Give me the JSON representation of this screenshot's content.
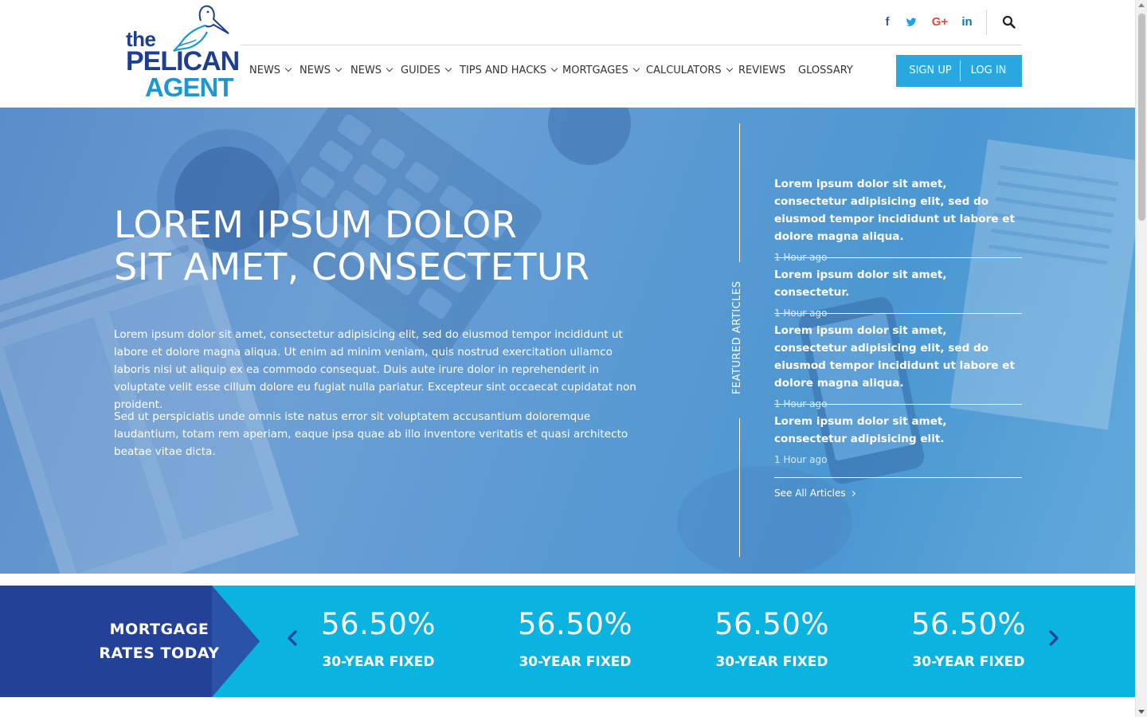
{
  "brand": {
    "logo_the": "the",
    "logo_pelican": "PELICAN",
    "logo_agent": "AGENT",
    "primary_color": "#1e3f8f",
    "accent_color": "#29a8e0"
  },
  "social": {
    "facebook": "f",
    "twitter": "t",
    "googleplus": "G+",
    "linkedin": "in"
  },
  "nav": {
    "items": [
      {
        "label": "NEWS",
        "dropdown": true
      },
      {
        "label": "NEWS",
        "dropdown": true
      },
      {
        "label": "NEWS",
        "dropdown": true
      },
      {
        "label": "GUIDES",
        "dropdown": true
      },
      {
        "label": "TIPS AND HACKS",
        "dropdown": true
      },
      {
        "label": "MORTGAGES",
        "dropdown": true
      },
      {
        "label": "CALCULATORS",
        "dropdown": true
      },
      {
        "label": "REVIEWS",
        "dropdown": false
      },
      {
        "label": "GLOSSARY",
        "dropdown": false
      }
    ]
  },
  "auth": {
    "signup_label": "SIGN UP",
    "login_label": "LOG IN"
  },
  "hero": {
    "title_line1": "LOREM IPSUM DOLOR",
    "title_line2": "SIT AMET, CONSECTETUR",
    "paragraph1": "Lorem ipsum dolor sit amet, consectetur adipisicing elit, sed do eiusmod tempor incididunt ut labore et dolore magna aliqua. Ut enim ad minim veniam, quis nostrud exercitation ullamco laboris nisi ut aliquip ex ea commodo consequat. Duis aute irure dolor in reprehenderit in voluptate velit esse cillum dolore eu fugiat nulla pariatur. Excepteur sint occaecat cupidatat non proident.",
    "paragraph2": "Sed ut perspiciatis unde omnis iste natus error sit voluptatem accusantium doloremque laudantium, totam rem aperiam, eaque ipsa quae ab illo inventore veritatis et quasi architecto beatae vitae dicta."
  },
  "featured": {
    "label": "FEATURED ARTICLES",
    "articles": [
      {
        "title": "Lorem ipsum dolor sit amet, consectetur adipisicing elit, sed do eiusmod tempor incididunt ut labore et dolore magna aliqua.",
        "time": "1 Hour ago"
      },
      {
        "title": "Lorem ipsum dolor sit amet, consectetur.",
        "time": "1 Hour ago"
      },
      {
        "title": "Lorem ipsum dolor sit amet, consectetur adipisicing elit, sed do eiusmod tempor incididunt ut labore et dolore magna aliqua.",
        "time": "1 Hour ago"
      },
      {
        "title": "Lorem ipsum dolor sit amet, consectetur adipisicing elit.",
        "time": "1 Hour ago"
      }
    ],
    "see_all": "See All Articles"
  },
  "rates": {
    "title_line1": "MORTGAGE",
    "title_line2": "RATES TODAY",
    "items": [
      {
        "value": "56.50%",
        "label": "30-YEAR FIXED"
      },
      {
        "value": "56.50%",
        "label": "30-YEAR FIXED"
      },
      {
        "value": "56.50%",
        "label": "30-YEAR FIXED"
      },
      {
        "value": "56.50%",
        "label": "30-YEAR FIXED"
      }
    ],
    "bar_color": "#0ab3e0",
    "label_color": "#234196"
  }
}
